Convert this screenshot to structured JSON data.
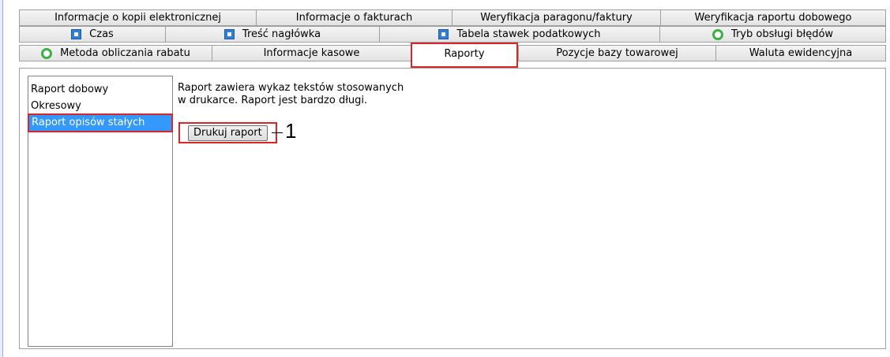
{
  "tabs": {
    "row1": [
      {
        "label": "Informacje o kopii elektronicznej"
      },
      {
        "label": "Informacje o fakturach"
      },
      {
        "label": "Weryfikacja paragonu/faktury"
      },
      {
        "label": "Weryfikacja raportu dobowego"
      }
    ],
    "row2": [
      {
        "label": "Czas",
        "icon": "blue-square-icon"
      },
      {
        "label": "Treść nagłówka",
        "icon": "blue-square-icon"
      },
      {
        "label": "Tabela stawek podatkowych",
        "icon": "blue-square-icon"
      },
      {
        "label": "Tryb obsługi błędów",
        "icon": "green-circle-icon"
      }
    ],
    "row3": [
      {
        "label": "Metoda obliczania rabatu",
        "icon": "green-circle-icon"
      },
      {
        "label": "Informacje kasowe"
      },
      {
        "label": "Raporty",
        "selected": true
      },
      {
        "label": "Pozycje bazy towarowej"
      },
      {
        "label": "Waluta ewidencyjna"
      }
    ]
  },
  "report_list": {
    "items": [
      {
        "label": "Raport dobowy"
      },
      {
        "label": "Okresowy"
      },
      {
        "label": "Raport opisów stałych",
        "selected": true
      }
    ]
  },
  "description": "Raport zawiera wykaz tekstów stosowanych\nw drukarce. Raport jest bardzo długi.",
  "print_button_label": "Drukuj raport",
  "callout_number": "1",
  "colors": {
    "highlight_red": "#d9262a",
    "selection_blue": "#3399ff",
    "icon_blue": "#2f7fd6",
    "icon_green": "#3cb043"
  }
}
